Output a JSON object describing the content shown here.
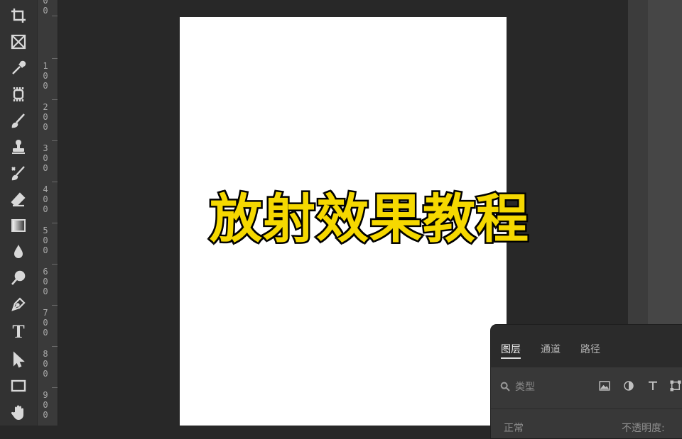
{
  "toolbar": {
    "tools": [
      {
        "name": "crop-icon"
      },
      {
        "name": "frame-icon"
      },
      {
        "name": "eyedropper-icon"
      },
      {
        "name": "spot-healing-icon"
      },
      {
        "name": "brush-icon"
      },
      {
        "name": "clone-stamp-icon"
      },
      {
        "name": "history-brush-icon"
      },
      {
        "name": "eraser-icon"
      },
      {
        "name": "gradient-icon"
      },
      {
        "name": "blur-icon"
      },
      {
        "name": "dodge-icon"
      },
      {
        "name": "pen-icon"
      },
      {
        "name": "type-icon",
        "glyph": "T"
      },
      {
        "name": "path-selection-icon"
      },
      {
        "name": "rectangle-icon"
      },
      {
        "name": "hand-icon"
      }
    ]
  },
  "ruler": {
    "labels": [
      "0\n0",
      "1\n0\n0",
      "2\n0\n0",
      "3\n0\n0",
      "4\n0\n0",
      "5\n0\n0",
      "6\n0\n0",
      "7\n0\n0",
      "8\n0\n0",
      "9\n0\n0"
    ]
  },
  "canvas": {
    "headline": "放射效果教程",
    "headline_color": "#f5d800",
    "background": "#ffffff"
  },
  "layers_panel": {
    "tabs": [
      "图层",
      "通道",
      "路径"
    ],
    "active_tab": "图层",
    "filter_placeholder": "类型",
    "blend_mode": "正常",
    "opacity_label": "不透明度:"
  }
}
